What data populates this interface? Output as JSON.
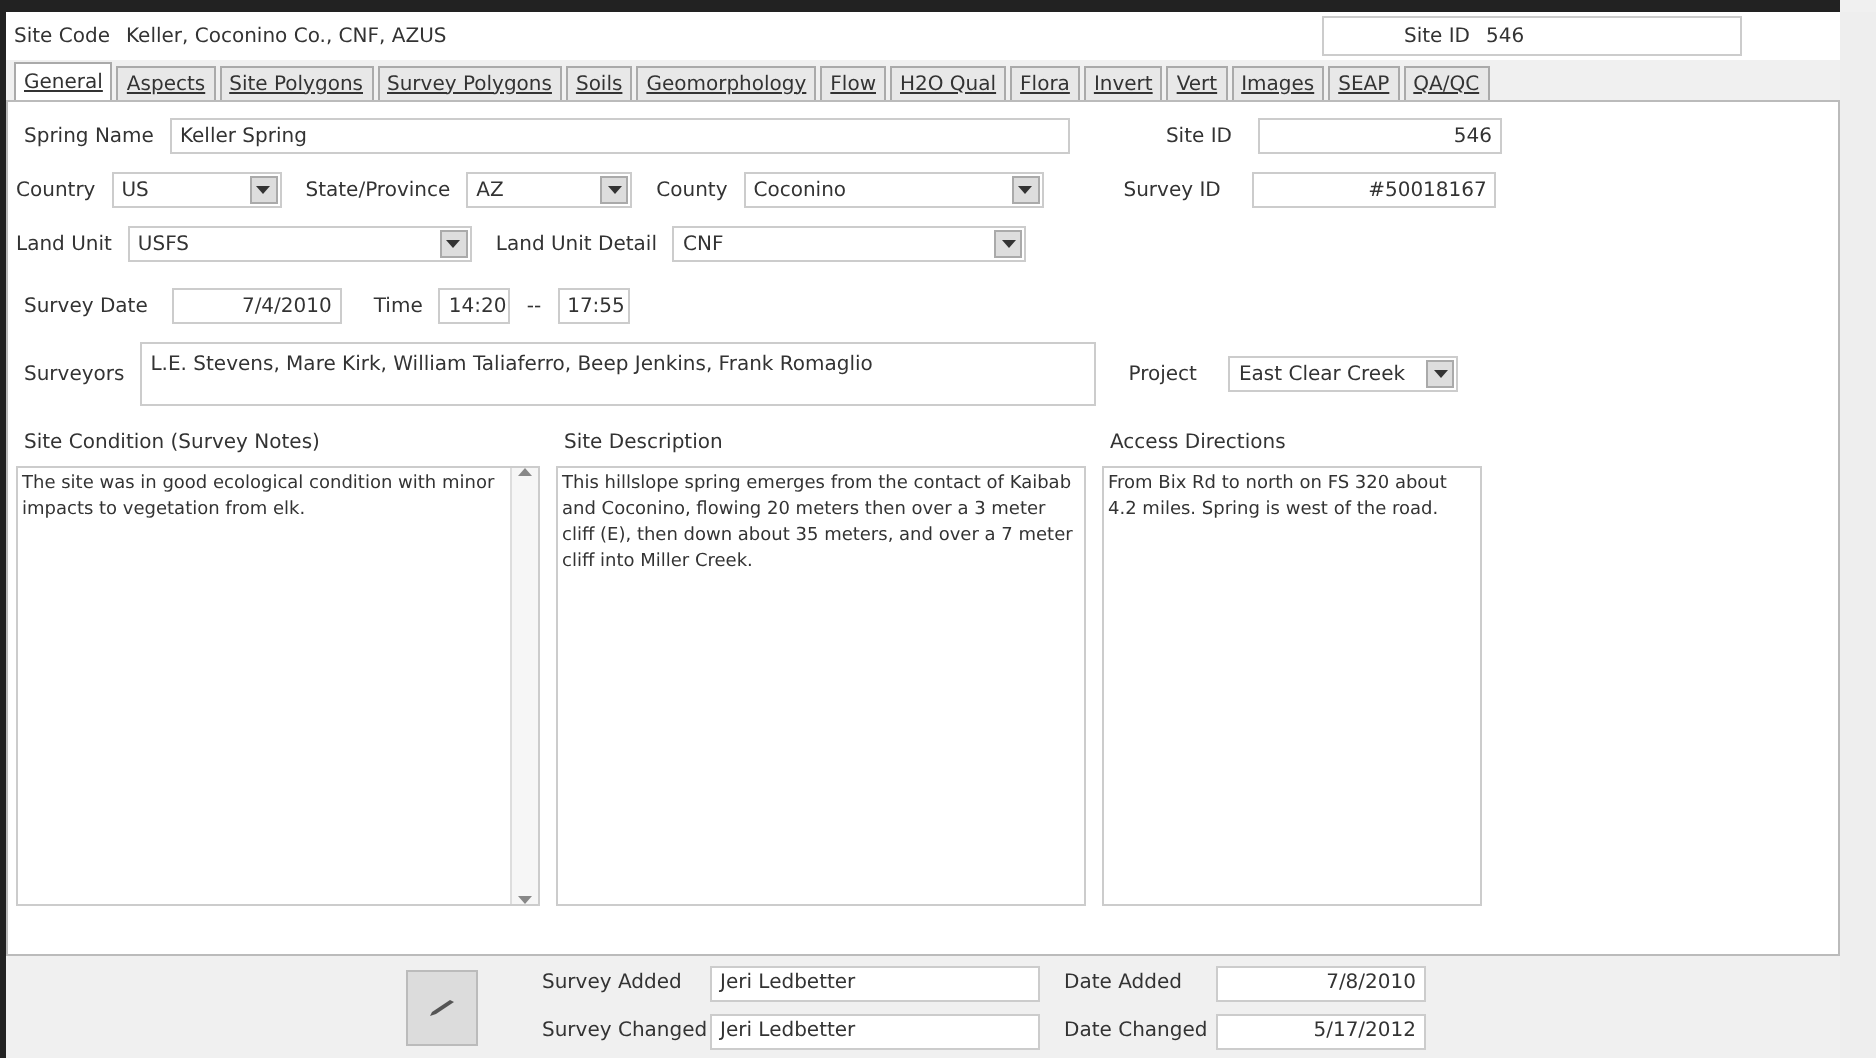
{
  "header": {
    "site_code_label": "Site Code",
    "site_code": "Keller, Coconino Co., CNF, AZUS",
    "site_id_label": "Site ID",
    "site_id": "546"
  },
  "tabs": [
    {
      "label": "General",
      "selected": true
    },
    {
      "label": "Aspects",
      "selected": false
    },
    {
      "label": "Site Polygons",
      "selected": false
    },
    {
      "label": "Survey Polygons",
      "selected": false
    },
    {
      "label": "Soils",
      "selected": false
    },
    {
      "label": "Geomorphology",
      "selected": false
    },
    {
      "label": "Flow",
      "selected": false
    },
    {
      "label": "H2O Qual",
      "selected": false
    },
    {
      "label": "Flora",
      "selected": false
    },
    {
      "label": "Invert",
      "selected": false
    },
    {
      "label": "Vert",
      "selected": false
    },
    {
      "label": "Images",
      "selected": false
    },
    {
      "label": "SEAP",
      "selected": false
    },
    {
      "label": "QA/QC",
      "selected": false
    }
  ],
  "form": {
    "spring_name": {
      "label": "Spring Name",
      "value": "Keller Spring"
    },
    "site_id": {
      "label": "Site ID",
      "value": "546"
    },
    "country": {
      "label": "Country",
      "value": "US"
    },
    "state": {
      "label": "State/Province",
      "value": "AZ"
    },
    "county": {
      "label": "County",
      "value": "Coconino"
    },
    "survey_id": {
      "label": "Survey ID",
      "value": "#50018167"
    },
    "land_unit": {
      "label": "Land Unit",
      "value": "USFS"
    },
    "land_unit_detail": {
      "label": "Land Unit Detail",
      "value": "CNF"
    },
    "survey_date": {
      "label": "Survey Date",
      "value": "7/4/2010"
    },
    "time": {
      "label": "Time",
      "start": "14:20",
      "separator": "--",
      "end": "17:55"
    },
    "surveyors": {
      "label": "Surveyors",
      "value": "L.E. Stevens, Mare Kirk, William Taliaferro, Beep Jenkins, Frank Romaglio"
    },
    "project": {
      "label": "Project",
      "value": "East Clear Creek"
    },
    "site_condition": {
      "label": "Site Condition (Survey Notes)",
      "value": "The site was in good ecological condition with minor impacts to vegetation from elk."
    },
    "site_description": {
      "label": "Site Description",
      "value": "This hillslope spring emerges from the contact of Kaibab and Coconino, flowing 20 meters then over a 3 meter cliff (E), then down about 35 meters, and over a 7 meter cliff into Miller Creek."
    },
    "access_directions": {
      "label": "Access Directions",
      "value": "From Bix Rd to north on FS 320 about 4.2 miles.  Spring is west of the road."
    }
  },
  "footer": {
    "survey_added_label": "Survey Added",
    "survey_added": "Jeri Ledbetter",
    "survey_changed_label": "Survey Changed",
    "survey_changed": "Jeri Ledbetter",
    "date_added_label": "Date Added",
    "date_added": "7/8/2010",
    "date_changed_label": "Date Changed",
    "date_changed": "5/17/2012"
  }
}
